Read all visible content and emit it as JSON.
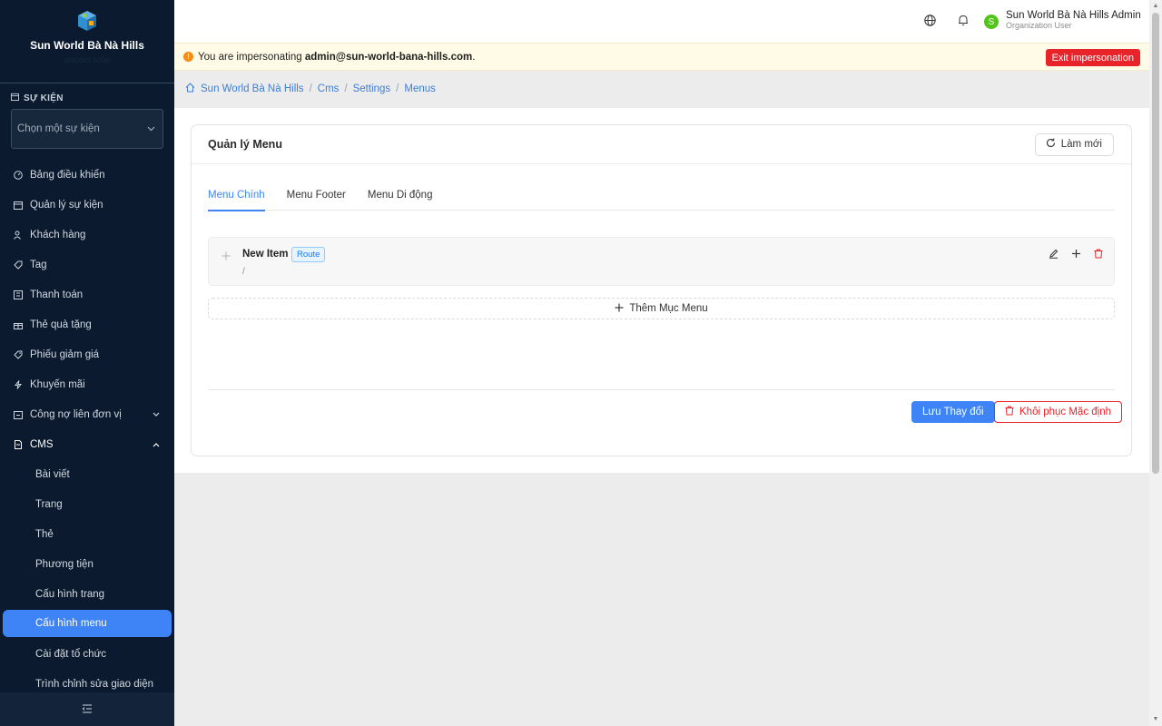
{
  "sidebar": {
    "brand_name": "Sun World Bà Nà Hills",
    "brand_sub": "unicorn.solar",
    "event_section_title": "SỰ KIỆN",
    "event_select_placeholder": "Chọn một sự kiện",
    "items": [
      {
        "label": "Bảng điều khiển",
        "icon": "dashboard-icon"
      },
      {
        "label": "Quản lý sự kiện",
        "icon": "calendar-icon"
      },
      {
        "label": "Khách hàng",
        "icon": "users-icon"
      },
      {
        "label": "Tag",
        "icon": "tag-icon"
      },
      {
        "label": "Thanh toán",
        "icon": "payment-icon"
      },
      {
        "label": "Thẻ quà tặng",
        "icon": "gift-icon"
      },
      {
        "label": "Phiếu giảm giá",
        "icon": "coupon-icon"
      },
      {
        "label": "Khuyến mãi",
        "icon": "lightning-icon"
      },
      {
        "label": "Công nợ liên đơn vị",
        "icon": "debt-icon"
      },
      {
        "label": "CMS",
        "icon": "document-icon"
      }
    ],
    "cms_subitems": [
      {
        "label": "Bài viết"
      },
      {
        "label": "Trang"
      },
      {
        "label": "Thẻ"
      },
      {
        "label": "Phương tiện"
      },
      {
        "label": "Cấu hình trang"
      },
      {
        "label": "Cấu hình menu"
      },
      {
        "label": "Cài đặt tổ chức"
      },
      {
        "label": "Trình chỉnh sửa giao diện"
      }
    ]
  },
  "topbar": {
    "user_initial": "S",
    "user_name": "Sun World Bà Nà Hills Admin",
    "user_role": "Organization User"
  },
  "impersonation": {
    "prefix": "You are impersonating ",
    "email": "admin@sun-world-bana-hills.com",
    "suffix": ".",
    "exit_label": "Exit impersonation"
  },
  "breadcrumb": [
    "Sun World Bà Nà Hills",
    "Cms",
    "Settings",
    "Menus"
  ],
  "card": {
    "title": "Quản lý Menu",
    "refresh_label": "Làm mới",
    "tabs": [
      "Menu Chính",
      "Menu Footer",
      "Menu Di động"
    ],
    "menu_item": {
      "title": "New Item",
      "type_badge": "Route",
      "path": "/"
    },
    "add_item_label": "Thêm Mục Menu",
    "save_label": "Lưu Thay đổi",
    "reset_label": "Khôi phục Mặc định"
  },
  "colors": {
    "accent": "#3e84f7",
    "sidebar_bg": "#0b1a2e",
    "danger": "#e8232a",
    "warning_bg": "#fffbe6"
  }
}
